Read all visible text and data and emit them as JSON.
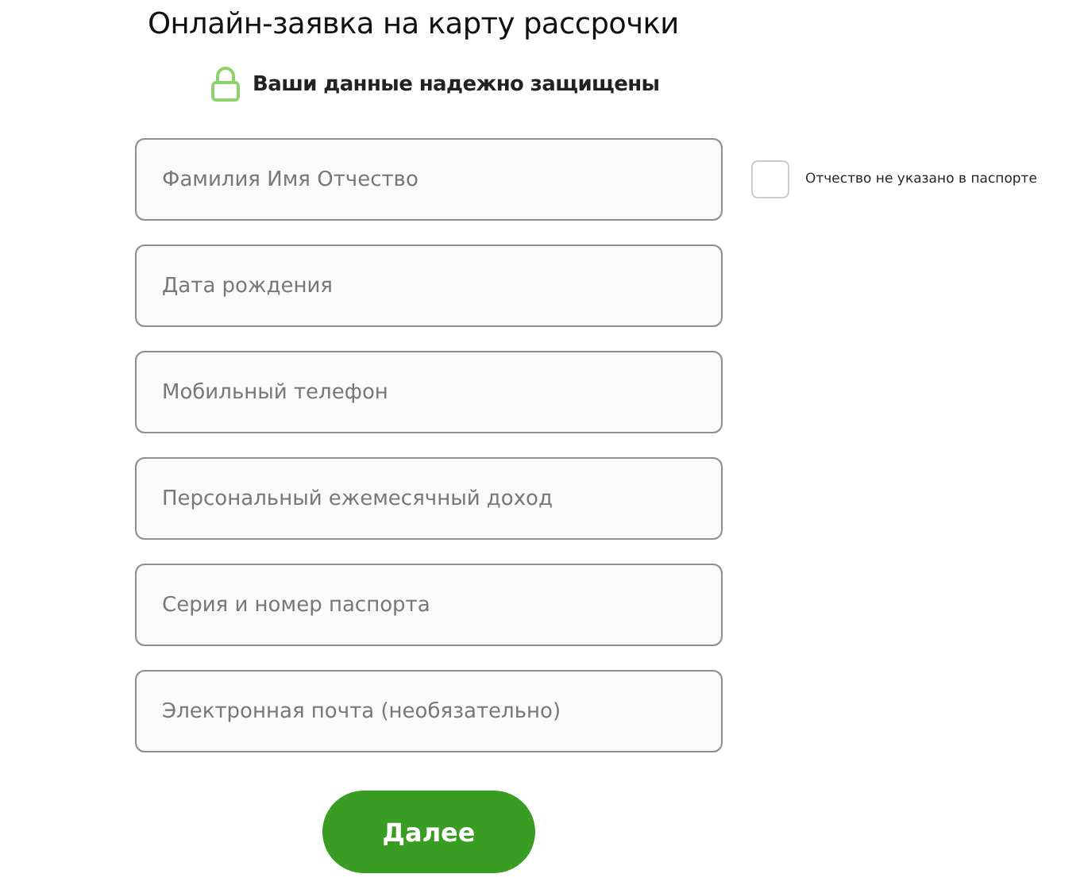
{
  "title": "Онлайн-заявка на карту рассрочки",
  "security_note": "Ваши данные надежно защищены",
  "fields": [
    {
      "placeholder": "Фамилия Имя Отчество"
    },
    {
      "placeholder": "Дата рождения"
    },
    {
      "placeholder": "Мобильный телефон"
    },
    {
      "placeholder": "Персональный ежемесячный доход"
    },
    {
      "placeholder": "Серия и номер паспорта"
    },
    {
      "placeholder": "Электронная почта (необязательно)"
    }
  ],
  "no_patronymic": {
    "label": "Отчество не указано в паспорте",
    "checked": false
  },
  "submit_button": "Далее"
}
